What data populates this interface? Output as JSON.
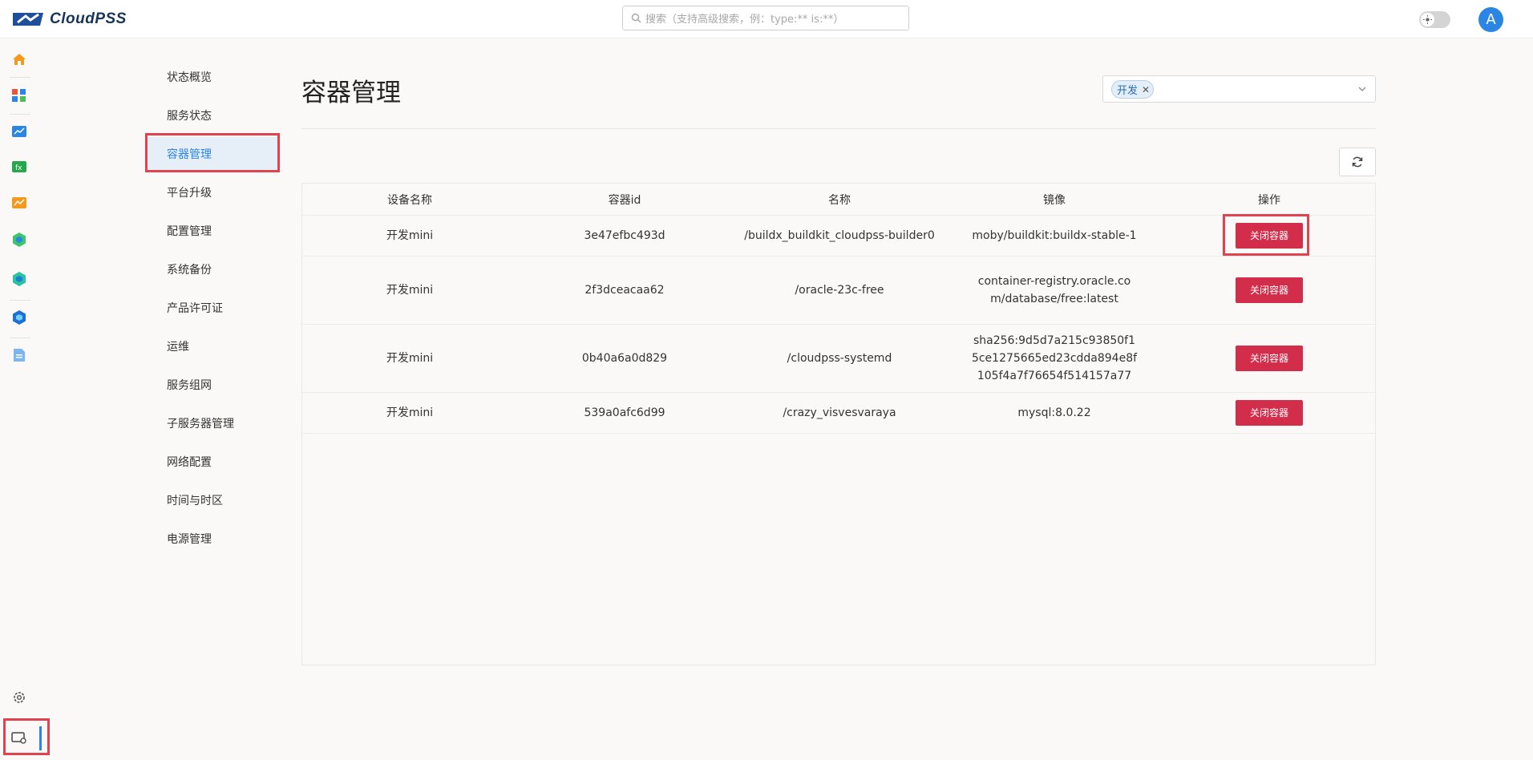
{
  "app": {
    "logo_text": "CloudPSS"
  },
  "search": {
    "placeholder": "搜索（支持高级搜索，例：type:** is:**）"
  },
  "user": {
    "avatar_initial": "A"
  },
  "rail": {
    "items": [
      "home-icon",
      "apps-icon",
      "chart-window-icon",
      "function-icon",
      "trend-icon",
      "hexagon-green-icon",
      "hexagon-teal-icon",
      "hexagon-blue-icon",
      "document-icon"
    ],
    "bottom": [
      "settings-icon",
      "device-settings-icon"
    ]
  },
  "subnav": {
    "items": [
      {
        "label": "状态概览"
      },
      {
        "label": "服务状态"
      },
      {
        "label": "容器管理",
        "active": true
      },
      {
        "label": "平台升级"
      },
      {
        "label": "配置管理"
      },
      {
        "label": "系统备份"
      },
      {
        "label": "产品许可证"
      },
      {
        "label": "运维"
      },
      {
        "label": "服务组网"
      },
      {
        "label": "子服务器管理"
      },
      {
        "label": "网络配置"
      },
      {
        "label": "时间与时区"
      },
      {
        "label": "电源管理"
      }
    ]
  },
  "main": {
    "title": "容器管理",
    "filter": {
      "selected_tag": "开发"
    }
  },
  "table": {
    "columns": [
      "设备名称",
      "容器id",
      "名称",
      "镜像",
      "操作"
    ],
    "rows": [
      {
        "device": "开发mini",
        "id": "3e47efbc493d",
        "name": "/buildx_buildkit_cloudpss-builder0",
        "image": "moby/buildkit:buildx-stable-1",
        "action": "关闭容器"
      },
      {
        "device": "开发mini",
        "id": "2f3dceacaa62",
        "name": "/oracle-23c-free",
        "image": "container-registry.oracle.com/database/free:latest",
        "action": "关闭容器"
      },
      {
        "device": "开发mini",
        "id": "0b40a6a0d829",
        "name": "/cloudpss-systemd",
        "image": "sha256:9d5d7a215c93850f15ce1275665ed23cdda894e8f105f4a7f76654f514157a77",
        "action": "关闭容器"
      },
      {
        "device": "开发mini",
        "id": "539a0afc6d99",
        "name": "/crazy_visvesvaraya",
        "image": "mysql:8.0.22",
        "action": "关闭容器"
      }
    ]
  },
  "colors": {
    "accent": "#2b85e4",
    "danger": "#d22d4a",
    "highlight_outline": "#e0424f"
  }
}
